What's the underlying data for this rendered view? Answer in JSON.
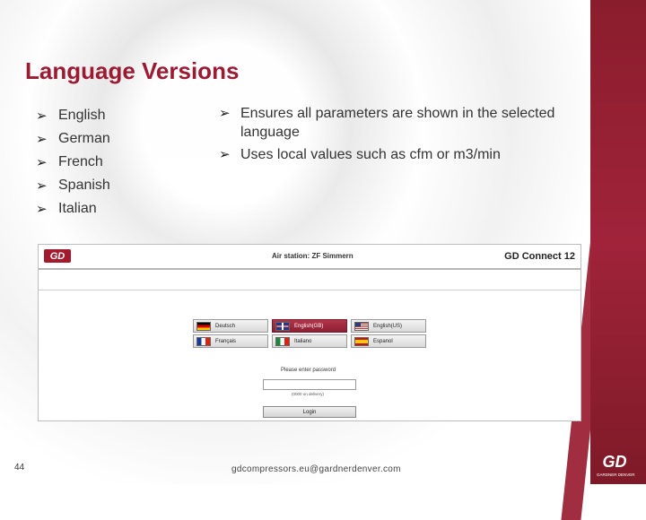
{
  "slide": {
    "title": "Language Versions",
    "languages": [
      "English",
      "German",
      "French",
      "Spanish",
      "Italian"
    ],
    "bullets": [
      "Ensures all parameters are shown in the selected language",
      "Uses local values such as cfm or m3/min"
    ],
    "page_number": "44",
    "footer_email": "gdcompressors.eu@gardnerdenver.com",
    "logo_text": "GD",
    "logo_subtext": "GARDNER DENVER"
  },
  "screenshot": {
    "logo_text": "GD",
    "station_title": "Air station: ZF Simmern",
    "product_title": "GD Connect 12",
    "language_buttons": [
      {
        "label": "Deutsch",
        "flag": "flag-de",
        "active": false
      },
      {
        "label": "English(GB)",
        "flag": "flag-gb",
        "active": true
      },
      {
        "label": "English(US)",
        "flag": "flag-us",
        "active": false
      },
      {
        "label": "Français",
        "flag": "flag-fr",
        "active": false
      },
      {
        "label": "Italiano",
        "flag": "flag-it",
        "active": false
      },
      {
        "label": "Espanol",
        "flag": "flag-es",
        "active": false
      }
    ],
    "password_prompt": "Please enter password",
    "password_value": "",
    "password_hint": "(0000 on delivery)",
    "login_label": "Login"
  },
  "colors": {
    "accent": "#9b1b32",
    "band": "#8a1d2c"
  }
}
